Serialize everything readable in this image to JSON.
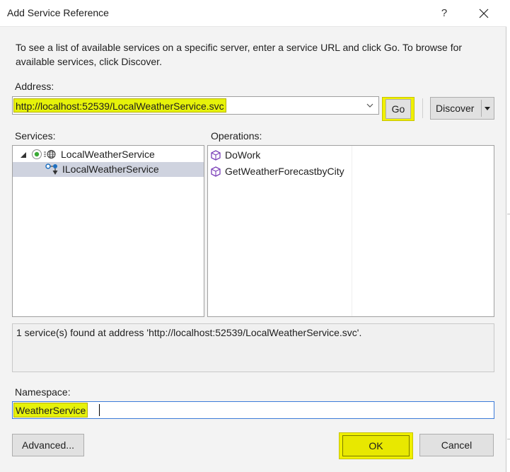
{
  "window": {
    "title": "Add Service Reference",
    "help_label": "?"
  },
  "instructions": "To see a list of available services on a specific server, enter a service URL and click Go. To browse for available services, click Discover.",
  "address": {
    "label": "Address:",
    "value": "http://localhost:52539/LocalWeatherService.svc"
  },
  "buttons": {
    "go": "Go",
    "discover": "Discover",
    "advanced": "Advanced...",
    "ok": "OK",
    "cancel": "Cancel"
  },
  "services": {
    "label": "Services:",
    "items": [
      {
        "label": "LocalWeatherService",
        "icon": "service-globe-icon",
        "expanded": true
      },
      {
        "label": "ILocalWeatherService",
        "icon": "interface-icon",
        "selected": true
      }
    ]
  },
  "operations": {
    "label": "Operations:",
    "items": [
      {
        "label": "DoWork",
        "icon": "method-icon"
      },
      {
        "label": "GetWeatherForecastbyCity",
        "icon": "method-icon"
      }
    ]
  },
  "status": "1 service(s) found at address 'http://localhost:52539/LocalWeatherService.svc'.",
  "namespace": {
    "label": "Namespace:",
    "value": "WeatherService"
  },
  "colors": {
    "highlight": "#f0f000",
    "selection": "#cfd3df",
    "dialog_bg": "#f3f3f3"
  }
}
